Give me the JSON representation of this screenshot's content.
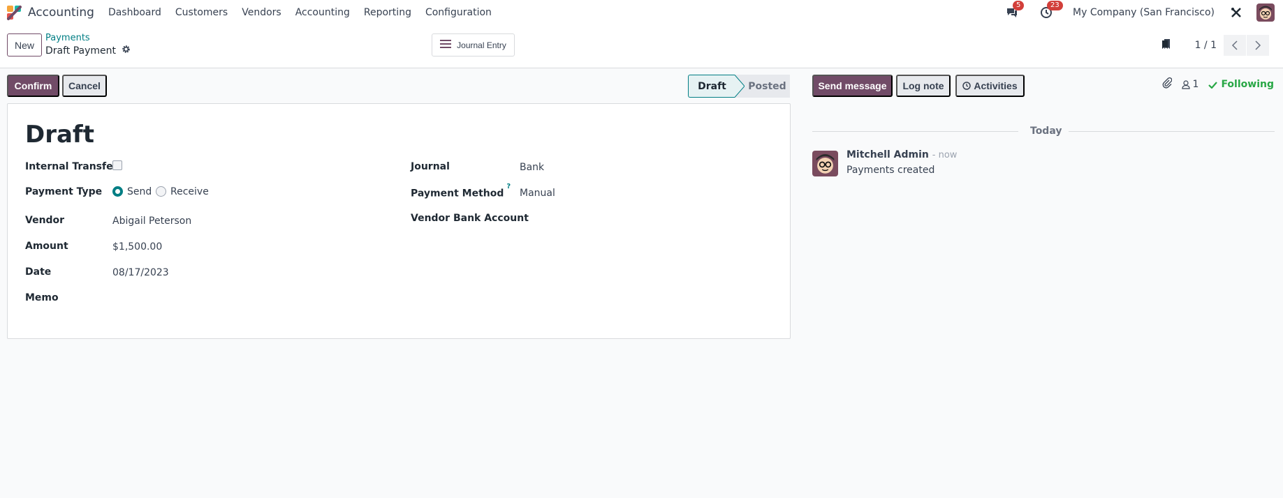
{
  "navbar": {
    "app_name": "Accounting",
    "menu": [
      "Dashboard",
      "Customers",
      "Vendors",
      "Accounting",
      "Reporting",
      "Configuration"
    ],
    "messages_count": "5",
    "activities_count": "23",
    "company": "My Company (San Francisco)"
  },
  "control": {
    "new_label": "New",
    "breadcrumb_parent": "Payments",
    "breadcrumb_current": "Draft Payment",
    "journal_entry_label": "Journal Entry",
    "pager_value": "1 / 1"
  },
  "statusbar": {
    "confirm_label": "Confirm",
    "cancel_label": "Cancel",
    "stages": [
      "Draft",
      "Posted"
    ],
    "active_stage": "Draft"
  },
  "form": {
    "title": "Draft",
    "left": {
      "internal_transfer_label": "Internal Transfer",
      "payment_type_label": "Payment Type",
      "payment_type_options": [
        "Send",
        "Receive"
      ],
      "payment_type_selected": "Send",
      "vendor_label": "Vendor",
      "vendor_value": "Abigail Peterson",
      "amount_label": "Amount",
      "amount_value": "$1,500.00",
      "date_label": "Date",
      "date_value": "08/17/2023",
      "memo_label": "Memo"
    },
    "right": {
      "journal_label": "Journal",
      "journal_value": "Bank",
      "payment_method_label": "Payment Method",
      "payment_method_help": "?",
      "payment_method_value": "Manual",
      "vendor_bank_label": "Vendor Bank Account"
    }
  },
  "chatter": {
    "send_message_label": "Send message",
    "log_note_label": "Log note",
    "activities_label": "Activities",
    "followers_count": "1",
    "following_label": "Following",
    "date_divider": "Today",
    "message": {
      "author": "Mitchell Admin",
      "time": "- now",
      "body": "Payments created"
    }
  },
  "colors": {
    "primary": "#714b67",
    "teal": "#017e84",
    "success": "#28a745",
    "badge": "#d23f3a"
  }
}
